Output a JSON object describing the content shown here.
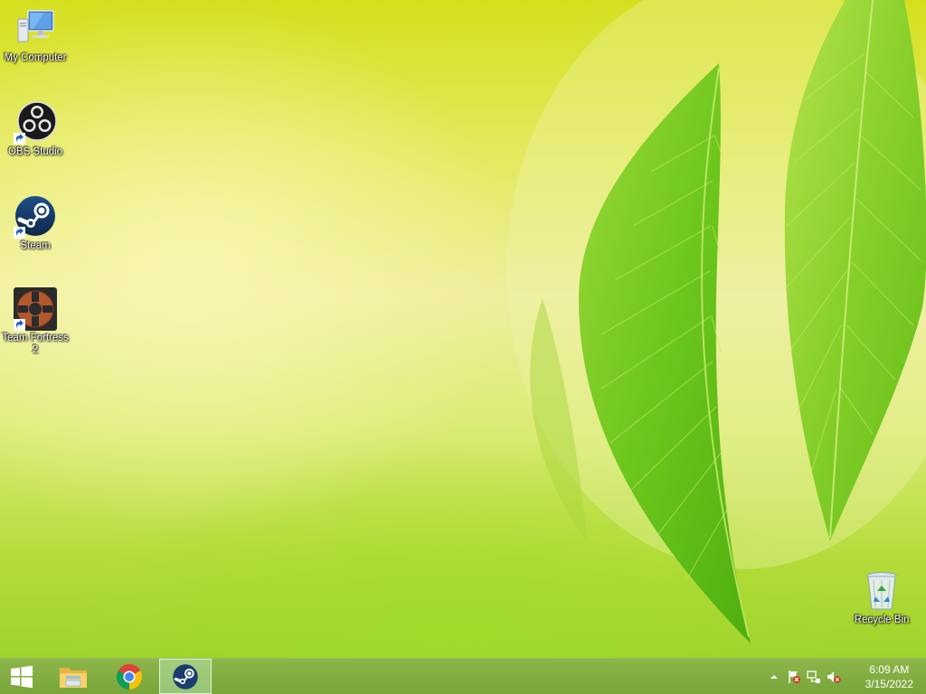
{
  "desktop": {
    "icons": [
      {
        "label": "My Computer",
        "icon": "computer-icon"
      },
      {
        "label": "OBS Studio",
        "icon": "obs-studio-icon"
      },
      {
        "label": "Steam",
        "icon": "steam-icon"
      },
      {
        "label": "Team Fortress 2",
        "icon": "team-fortress-2-icon"
      },
      {
        "label": "Recycle Bin",
        "icon": "recycle-bin-icon"
      }
    ]
  },
  "taskbar": {
    "start_icon": "windows-logo-icon",
    "pinned": [
      {
        "name": "File Explorer",
        "icon": "folder-icon",
        "active": false
      },
      {
        "name": "Google Chrome",
        "icon": "chrome-icon",
        "active": false
      },
      {
        "name": "Steam",
        "icon": "steam-icon",
        "active": true
      }
    ],
    "tray": {
      "icons": [
        "show-hidden-icons-chevron-icon",
        "action-center-flag-icon",
        "network-icon",
        "volume-muted-icon"
      ]
    },
    "clock": {
      "time": "6:09 AM",
      "date": "3/15/2022"
    }
  },
  "colors": {
    "taskbar": "#82ae42",
    "wallpaper_main": "#e3ea62",
    "steam_blue": "#1b3d6e"
  }
}
